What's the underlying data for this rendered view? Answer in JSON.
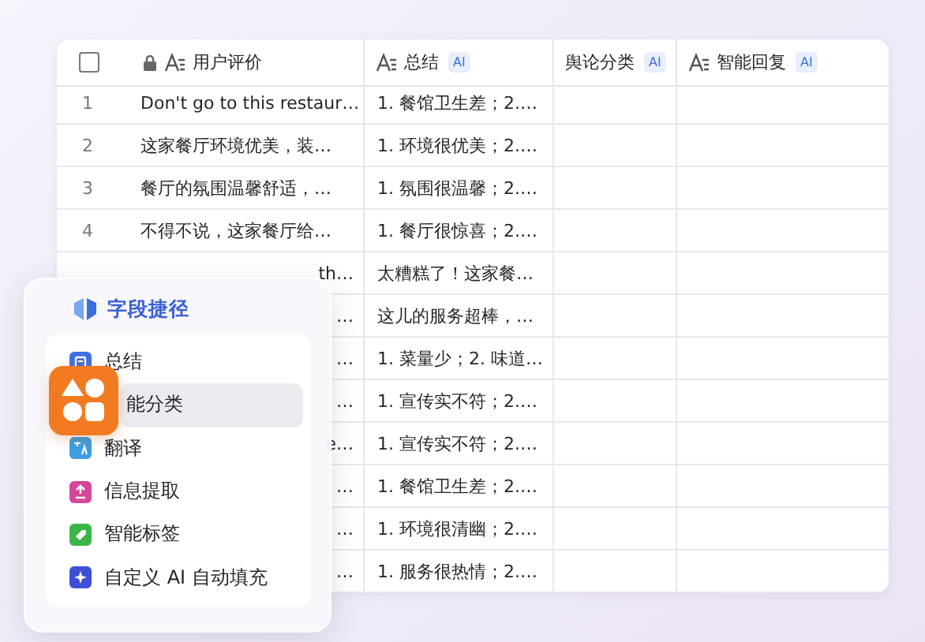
{
  "table": {
    "select_all_checked": false,
    "columns": [
      {
        "label": "用户评价",
        "locked": true,
        "text_type": true
      },
      {
        "label": "总结",
        "locked": false,
        "text_type": true,
        "badge": "AI"
      },
      {
        "label": "舆论分类",
        "locked": false,
        "text_type": false,
        "badge": "AI"
      },
      {
        "label": "智能回复",
        "locked": false,
        "text_type": true,
        "badge": "AI"
      }
    ],
    "rows": [
      {
        "number": "1",
        "cells": [
          "Don't go to this restaur…",
          "1. 餐馆卫生差；2.…"
        ]
      },
      {
        "number": "2",
        "cells": [
          "这家餐厅环境优美，装…",
          "1. 环境很优美；2.…"
        ]
      },
      {
        "number": "3",
        "cells": [
          "餐厅的氛围温馨舒适，…",
          "1. 氛围很温馨；2.…"
        ]
      },
      {
        "number": "4",
        "cells": [
          "不得不说，这家餐厅给…",
          "1. 餐厅很惊喜；2.…"
        ]
      },
      {
        "cells": [
          "th…",
          "太糟糕了！这家餐…"
        ]
      },
      {
        "cells": [
          "…",
          "这儿的服务超棒，…"
        ]
      },
      {
        "cells": [
          "…",
          "1. 菜量少；2. 味道…"
        ]
      },
      {
        "cells": [
          "…",
          "1. 宣传实不符；2.…"
        ]
      },
      {
        "cells": [
          "e…",
          "1. 宣传实不符；2.…"
        ]
      },
      {
        "cells": [
          "…",
          "1. 餐馆卫生差；2.…"
        ]
      },
      {
        "cells": [
          "…",
          "1. 环境很清幽；2.…"
        ]
      },
      {
        "cells": [
          "…",
          "1. 服务很热情；2.…"
        ]
      }
    ]
  },
  "shortcut_panel": {
    "title": "字段捷径",
    "items": [
      {
        "label": "总结",
        "kind": "summary",
        "selected": false
      },
      {
        "label": "能分类",
        "kind": "covered",
        "selected": true
      },
      {
        "label": "翻译",
        "kind": "translate",
        "selected": false
      },
      {
        "label": "信息提取",
        "kind": "extract",
        "selected": false
      },
      {
        "label": "智能标签",
        "kind": "tag",
        "selected": false
      },
      {
        "label": "自定义 AI 自动填充",
        "kind": "custom",
        "selected": false
      }
    ]
  }
}
